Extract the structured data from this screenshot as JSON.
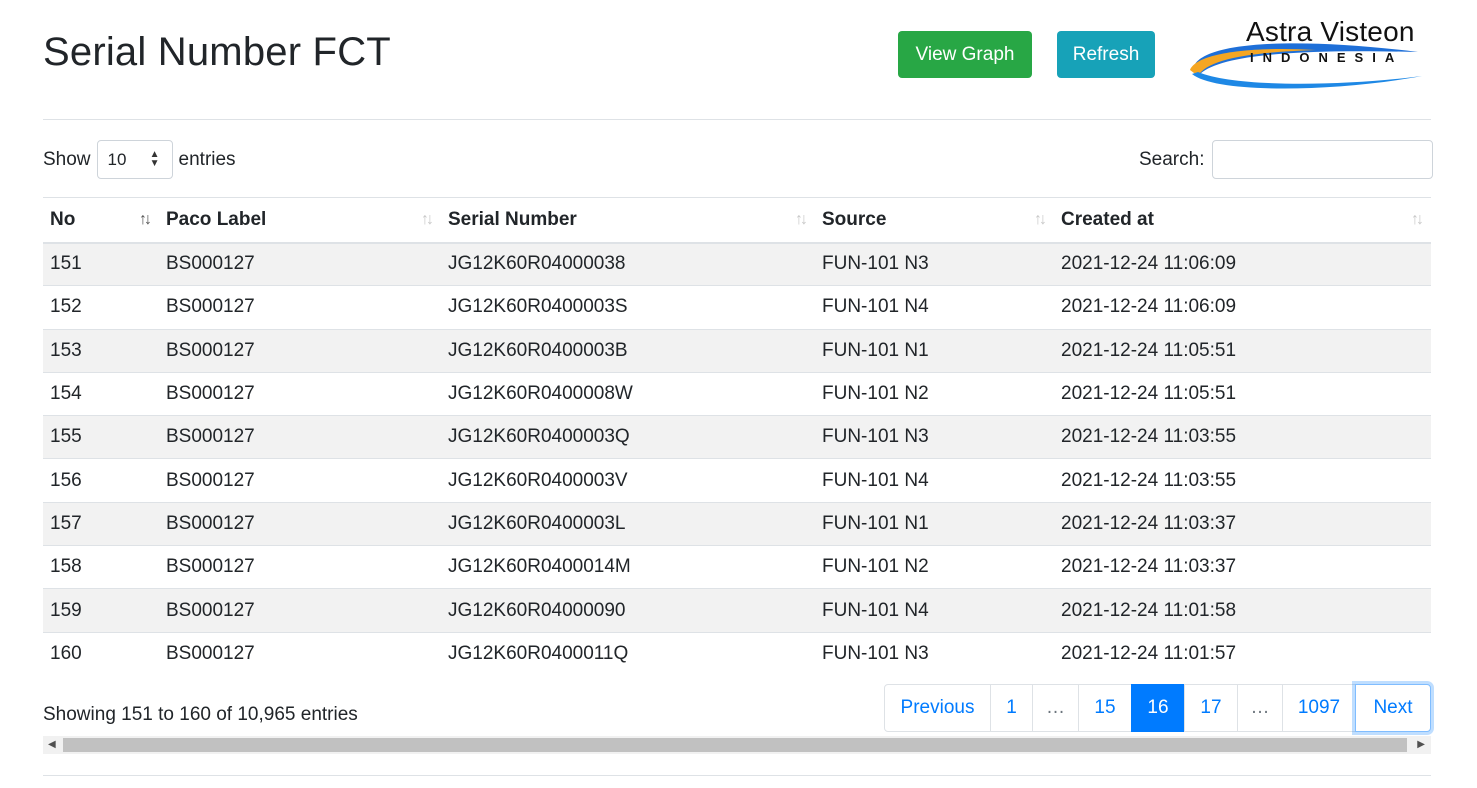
{
  "header": {
    "title": "Serial Number FCT",
    "view_graph_label": "View Graph",
    "refresh_label": "Refresh",
    "logo_name": "Astra Visteon",
    "logo_sub": "INDONESIA",
    "colors": {
      "success": "#28a745",
      "info": "#17a2b8",
      "primary": "#007bff"
    }
  },
  "controls": {
    "show_label": "Show",
    "entries_select": "10",
    "entries_label": "entries",
    "search_label": "Search:",
    "search_value": ""
  },
  "table": {
    "columns": [
      "No",
      "Paco Label",
      "Serial Number",
      "Source",
      "Created at"
    ],
    "rows": [
      [
        "151",
        "BS000127",
        "JG12K60R04000038",
        "FUN-101 N3",
        "2021-12-24 11:06:09"
      ],
      [
        "152",
        "BS000127",
        "JG12K60R0400003S",
        "FUN-101 N4",
        "2021-12-24 11:06:09"
      ],
      [
        "153",
        "BS000127",
        "JG12K60R0400003B",
        "FUN-101 N1",
        "2021-12-24 11:05:51"
      ],
      [
        "154",
        "BS000127",
        "JG12K60R0400008W",
        "FUN-101 N2",
        "2021-12-24 11:05:51"
      ],
      [
        "155",
        "BS000127",
        "JG12K60R0400003Q",
        "FUN-101 N3",
        "2021-12-24 11:03:55"
      ],
      [
        "156",
        "BS000127",
        "JG12K60R0400003V",
        "FUN-101 N4",
        "2021-12-24 11:03:55"
      ],
      [
        "157",
        "BS000127",
        "JG12K60R0400003L",
        "FUN-101 N1",
        "2021-12-24 11:03:37"
      ],
      [
        "158",
        "BS000127",
        "JG12K60R0400014M",
        "FUN-101 N2",
        "2021-12-24 11:03:37"
      ],
      [
        "159",
        "BS000127",
        "JG12K60R04000090",
        "FUN-101 N4",
        "2021-12-24 11:01:58"
      ],
      [
        "160",
        "BS000127",
        "JG12K60R0400011Q",
        "FUN-101 N3",
        "2021-12-24 11:01:57"
      ]
    ]
  },
  "footer": {
    "info": "Showing 151 to 160 of 10,965 entries",
    "pagination": [
      "Previous",
      "1",
      "…",
      "15",
      "16",
      "17",
      "…",
      "1097",
      "Next"
    ],
    "active_page": "16"
  }
}
